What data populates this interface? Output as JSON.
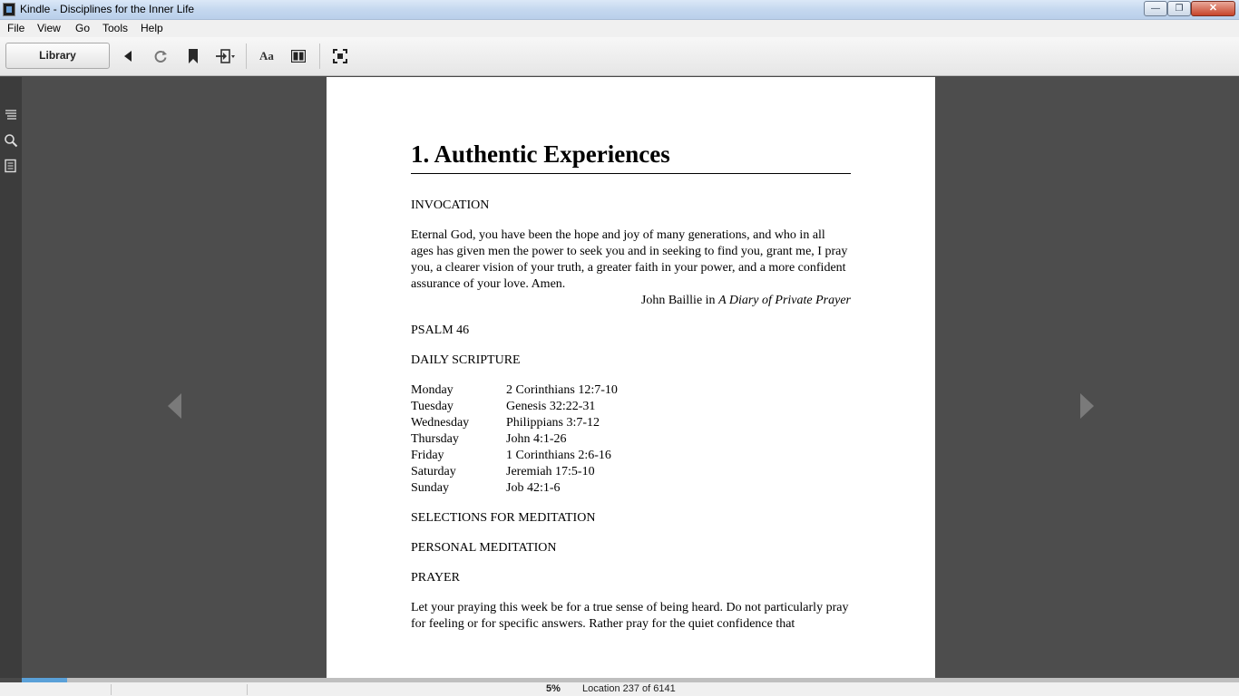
{
  "window": {
    "title": "Kindle - Disciplines for the Inner Life",
    "minimize_glyph": "—",
    "maximize_glyph": "❐",
    "close_glyph": "✕"
  },
  "menu": {
    "items": [
      {
        "label": "File"
      },
      {
        "label": "View"
      },
      {
        "label": "Go"
      },
      {
        "label": "Tools"
      },
      {
        "label": "Help"
      }
    ]
  },
  "toolbar": {
    "library_label": "Library",
    "font_label": "Aa",
    "icons": [
      "back-icon",
      "sync-icon",
      "bookmark-icon",
      "goto-icon",
      "font-settings-icon",
      "columns-icon",
      "fullscreen-icon"
    ]
  },
  "sidebar": {
    "icons": [
      "table-of-contents-icon",
      "search-icon",
      "notes-icon"
    ]
  },
  "book": {
    "chapter_title": "1. Authentic Experiences",
    "invocation_head": "INVOCATION",
    "invocation_text": "Eternal God, you have been the hope and joy of many generations, and who in all ages has given men the power to seek you and in seeking to find you, grant me, I pray you, a clearer vision of your truth, a greater faith in your power, and a more confident assurance of your love. Amen.",
    "attribution_author": "John Baillie in ",
    "attribution_title": "A Diary of Private Prayer",
    "psalm_head": "PSALM 46",
    "daily_head": "DAILY SCRIPTURE",
    "schedule": [
      {
        "day": "Monday",
        "ref": "2 Corinthians 12:7-10"
      },
      {
        "day": "Tuesday",
        "ref": "Genesis 32:22-31"
      },
      {
        "day": "Wednesday",
        "ref": "Philippians 3:7-12"
      },
      {
        "day": "Thursday",
        "ref": "John 4:1-26"
      },
      {
        "day": "Friday",
        "ref": "1 Corinthians 2:6-16"
      },
      {
        "day": "Saturday",
        "ref": "Jeremiah 17:5-10"
      },
      {
        "day": "Sunday",
        "ref": "Job 42:1-6"
      }
    ],
    "selections_head": "SELECTIONS FOR MEDITATION",
    "personal_head": "PERSONAL MEDITATION",
    "prayer_head": "PRAYER",
    "prayer_text": "Let your praying this week be for a true sense of being heard. Do not particularly pray for feeling or for specific answers. Rather pray for the quiet confidence that"
  },
  "status": {
    "percent": "5%",
    "location": "Location 237 of 6141",
    "progress_fraction": 0.05
  },
  "colors": {
    "progress": "#5aa0d8",
    "reader_bg": "#4d4d4d",
    "page_bg": "#ffffff"
  }
}
